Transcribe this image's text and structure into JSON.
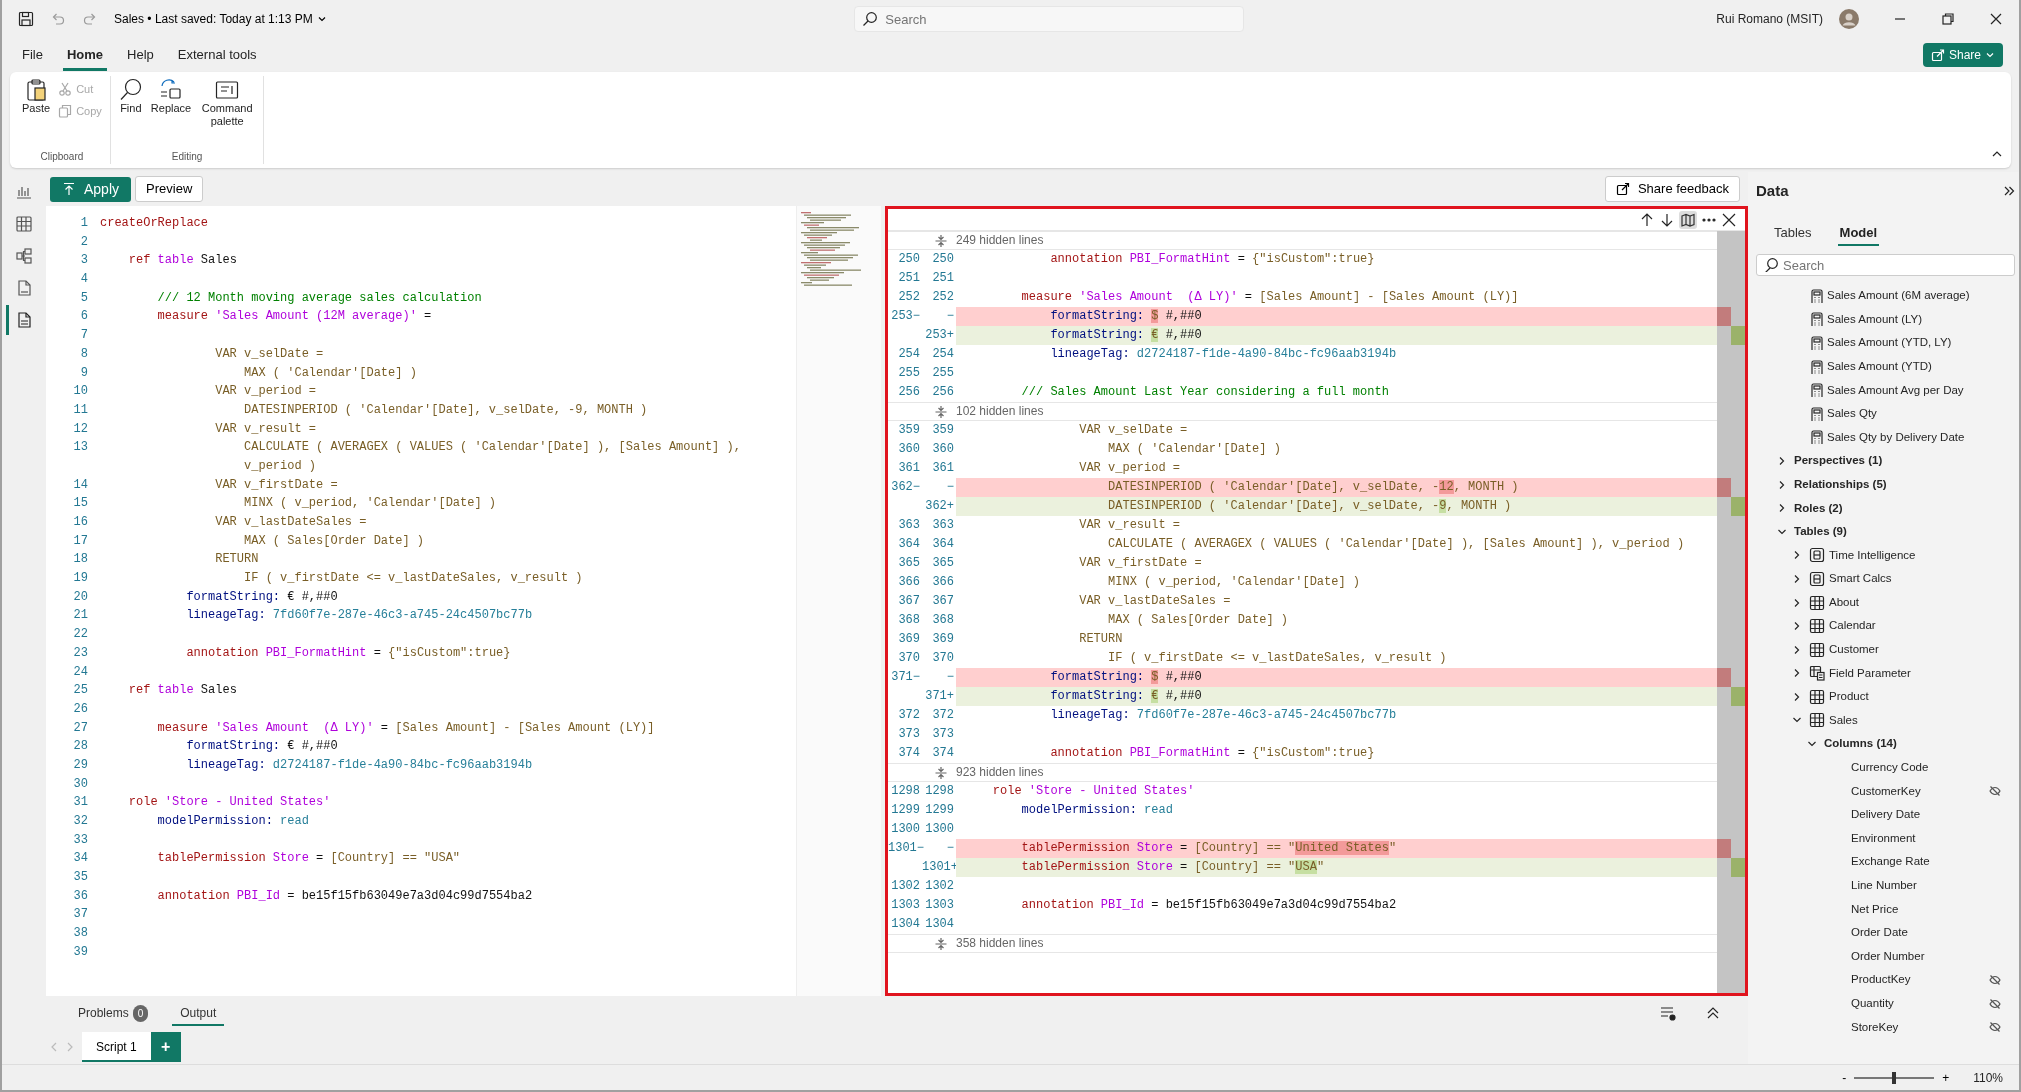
{
  "title_bar": {
    "document": "Sales • Last saved: Today at 1:13 PM",
    "search": {
      "placeholder": "Search"
    },
    "user": "Rui Romano (MSIT)"
  },
  "menu_tabs": [
    {
      "label": "File",
      "selected": false
    },
    {
      "label": "Home",
      "selected": true
    },
    {
      "label": "Help",
      "selected": false
    },
    {
      "label": "External tools",
      "selected": false
    }
  ],
  "share_button": {
    "label": "Share"
  },
  "ribbon": [
    {
      "group": "Clipboard",
      "commands": [
        {
          "label": "Paste",
          "kind": "paste",
          "disabled": false
        },
        {
          "label": "Cut",
          "kind": "cut",
          "disabled": true
        },
        {
          "label": "Copy",
          "kind": "copy",
          "disabled": true
        }
      ]
    },
    {
      "group": "Editing",
      "commands": [
        {
          "label": "Find",
          "kind": "find",
          "disabled": false
        },
        {
          "label": "Replace",
          "kind": "replace",
          "disabled": false
        },
        {
          "label": "Command palette",
          "kind": "palette",
          "disabled": false
        }
      ]
    }
  ],
  "view_rail": [
    {
      "kind": "report",
      "selected": false
    },
    {
      "kind": "table",
      "selected": false
    },
    {
      "kind": "model",
      "selected": false
    },
    {
      "kind": "dax",
      "selected": false
    },
    {
      "kind": "tmdl",
      "selected": true
    }
  ],
  "toolbar": {
    "apply": "Apply",
    "preview": "Preview",
    "share_feedback": "Share feedback"
  },
  "editor": {
    "lines": [
      {
        "number": "1",
        "tokens": [
          {
            "kind": "keyword",
            "text": "createOrReplace"
          }
        ]
      },
      {
        "number": "2"
      },
      {
        "number": "3",
        "tokens": [
          {
            "kind": "keyword",
            "text": "    ref "
          },
          {
            "kind": "name",
            "text": "table"
          },
          {
            "kind": "plain",
            "text": " Sales"
          }
        ]
      },
      {
        "number": "4"
      },
      {
        "number": "5",
        "tokens": [
          {
            "kind": "comment",
            "text": "        /// 12 Month moving average sales calculation"
          }
        ]
      },
      {
        "number": "6",
        "tokens": [
          {
            "kind": "keyword",
            "text": "        measure "
          },
          {
            "kind": "name",
            "text": "'Sales Amount (12M average)'"
          },
          {
            "kind": "plain",
            "text": " ="
          }
        ]
      },
      {
        "number": "7"
      },
      {
        "number": "8",
        "tokens": [
          {
            "kind": "dax",
            "text": "                VAR v_selDate ="
          }
        ]
      },
      {
        "number": "9",
        "tokens": [
          {
            "kind": "dax",
            "text": "                    MAX ( 'Calendar'[Date] )"
          }
        ]
      },
      {
        "number": "10",
        "tokens": [
          {
            "kind": "dax",
            "text": "                VAR v_period ="
          }
        ]
      },
      {
        "number": "11",
        "tokens": [
          {
            "kind": "dax",
            "text": "                    DATESINPERIOD ( 'Calendar'[Date], v_selDate, -9, MONTH )"
          }
        ]
      },
      {
        "number": "12",
        "tokens": [
          {
            "kind": "dax",
            "text": "                VAR v_result ="
          }
        ]
      },
      {
        "number": "13",
        "tokens": [
          {
            "kind": "dax",
            "text": "                    CALCULATE ( AVERAGEX ( VALUES ( 'Calendar'[Date] ), [Sales Amount] ),"
          }
        ]
      },
      {
        "tokens": [
          {
            "kind": "dax",
            "text": "                    v_period )"
          }
        ]
      },
      {
        "number": "14",
        "tokens": [
          {
            "kind": "dax",
            "text": "                VAR v_firstDate ="
          }
        ]
      },
      {
        "number": "15",
        "tokens": [
          {
            "kind": "dax",
            "text": "                    MINX ( v_period, 'Calendar'[Date] )"
          }
        ]
      },
      {
        "number": "16",
        "tokens": [
          {
            "kind": "dax",
            "text": "                VAR v_lastDateSales ="
          }
        ]
      },
      {
        "number": "17",
        "tokens": [
          {
            "kind": "dax",
            "text": "                    MAX ( Sales[Order Date] )"
          }
        ]
      },
      {
        "number": "18",
        "tokens": [
          {
            "kind": "dax",
            "text": "                RETURN"
          }
        ]
      },
      {
        "number": "19",
        "tokens": [
          {
            "kind": "dax",
            "text": "                    IF ( v_firstDate <= v_lastDateSales, v_result )"
          }
        ]
      },
      {
        "number": "20",
        "tokens": [
          {
            "kind": "property",
            "text": "            formatString:"
          },
          {
            "kind": "plain",
            "text": " € #,##0"
          }
        ]
      },
      {
        "number": "21",
        "tokens": [
          {
            "kind": "property",
            "text": "            lineageTag:"
          },
          {
            "kind": "value",
            "text": " 7fd60f7e-287e-46c3-a745-24c4507bc77b"
          }
        ]
      },
      {
        "number": "22"
      },
      {
        "number": "23",
        "tokens": [
          {
            "kind": "keyword",
            "text": "            annotation "
          },
          {
            "kind": "name",
            "text": "PBI_FormatHint"
          },
          {
            "kind": "plain",
            "text": " = "
          },
          {
            "kind": "dax",
            "text": "{\"isCustom\":true}"
          }
        ]
      },
      {
        "number": "24"
      },
      {
        "number": "25",
        "tokens": [
          {
            "kind": "keyword",
            "text": "    ref "
          },
          {
            "kind": "name",
            "text": "table"
          },
          {
            "kind": "plain",
            "text": " Sales"
          }
        ]
      },
      {
        "number": "26"
      },
      {
        "number": "27",
        "tokens": [
          {
            "kind": "keyword",
            "text": "        measure "
          },
          {
            "kind": "name",
            "text": "'Sales Amount  (Δ LY)'"
          },
          {
            "kind": "plain",
            "text": " = "
          },
          {
            "kind": "dax",
            "text": "[Sales Amount] - [Sales Amount (LY)]"
          }
        ]
      },
      {
        "number": "28",
        "tokens": [
          {
            "kind": "property",
            "text": "            formatString:"
          },
          {
            "kind": "plain",
            "text": " € #,##0"
          }
        ]
      },
      {
        "number": "29",
        "tokens": [
          {
            "kind": "property",
            "text": "            lineageTag:"
          },
          {
            "kind": "value",
            "text": " d2724187-f1de-4a90-84bc-fc96aab3194b"
          }
        ]
      },
      {
        "number": "30"
      },
      {
        "number": "31",
        "tokens": [
          {
            "kind": "keyword",
            "text": "    role "
          },
          {
            "kind": "name",
            "text": "'Store - United States'"
          }
        ]
      },
      {
        "number": "32",
        "tokens": [
          {
            "kind": "property",
            "text": "        modelPermission:"
          },
          {
            "kind": "value",
            "text": " read"
          }
        ]
      },
      {
        "number": "33"
      },
      {
        "number": "34",
        "tokens": [
          {
            "kind": "keyword",
            "text": "        tablePermission "
          },
          {
            "kind": "name",
            "text": "Store"
          },
          {
            "kind": "plain",
            "text": " = "
          },
          {
            "kind": "dax",
            "text": "[Country] == \"USA\""
          }
        ]
      },
      {
        "number": "35"
      },
      {
        "number": "36",
        "tokens": [
          {
            "kind": "keyword",
            "text": "        annotation "
          },
          {
            "kind": "name",
            "text": "PBI_Id"
          },
          {
            "kind": "plain",
            "text": " = be15f15fb63049e7a3d04c99d7554ba2"
          }
        ]
      },
      {
        "number": "37"
      },
      {
        "number": "38"
      },
      {
        "number": "39"
      }
    ]
  },
  "diff": {
    "rows": [
      {
        "kind": "hidden",
        "text": "249 hidden lines"
      },
      {
        "kind": "same",
        "old": "250",
        "new": "250",
        "tokens": [
          {
            "kind": "keyword",
            "text": "            annotation "
          },
          {
            "kind": "name",
            "text": "PBI_FormatHint"
          },
          {
            "kind": "plain",
            "text": " = "
          },
          {
            "kind": "dax",
            "text": "{\"isCustom\":true}"
          }
        ]
      },
      {
        "kind": "same",
        "old": "251",
        "new": "251"
      },
      {
        "kind": "same",
        "old": "252",
        "new": "252",
        "tokens": [
          {
            "kind": "keyword",
            "text": "        measure "
          },
          {
            "kind": "name",
            "text": "'Sales Amount  (Δ LY)'"
          },
          {
            "kind": "plain",
            "text": " = "
          },
          {
            "kind": "dax",
            "text": "[Sales Amount] - [Sales Amount (LY)]"
          }
        ]
      },
      {
        "kind": "removed",
        "old": "253−",
        "new": "−",
        "tokens": [
          {
            "kind": "property",
            "text": "            formatString: "
          },
          {
            "kind": "deleted",
            "text": "$"
          },
          {
            "kind": "plain",
            "text": " #,##0"
          }
        ]
      },
      {
        "kind": "added",
        "new": "253+",
        "tokens": [
          {
            "kind": "property",
            "text": "            formatString: "
          },
          {
            "kind": "inserted",
            "text": "€"
          },
          {
            "kind": "plain",
            "text": " #,##0"
          }
        ]
      },
      {
        "kind": "same",
        "old": "254",
        "new": "254",
        "tokens": [
          {
            "kind": "property",
            "text": "            lineageTag:"
          },
          {
            "kind": "value",
            "text": " d2724187-f1de-4a90-84bc-fc96aab3194b"
          }
        ]
      },
      {
        "kind": "same",
        "old": "255",
        "new": "255"
      },
      {
        "kind": "same",
        "old": "256",
        "new": "256",
        "tokens": [
          {
            "kind": "comment",
            "text": "        /// Sales Amount Last Year considering a full month"
          }
        ]
      },
      {
        "kind": "hidden",
        "text": "102 hidden lines"
      },
      {
        "kind": "same",
        "old": "359",
        "new": "359",
        "tokens": [
          {
            "kind": "dax",
            "text": "                VAR v_selDate ="
          }
        ]
      },
      {
        "kind": "same",
        "old": "360",
        "new": "360",
        "tokens": [
          {
            "kind": "dax",
            "text": "                    MAX ( 'Calendar'[Date] )"
          }
        ]
      },
      {
        "kind": "same",
        "old": "361",
        "new": "361",
        "tokens": [
          {
            "kind": "dax",
            "text": "                VAR v_period ="
          }
        ]
      },
      {
        "kind": "removed",
        "old": "362−",
        "new": "−",
        "tokens": [
          {
            "kind": "dax",
            "text": "                    DATESINPERIOD ( 'Calendar'[Date], v_selDate, -"
          },
          {
            "kind": "deleted",
            "text": "12"
          },
          {
            "kind": "dax",
            "text": ", MONTH )"
          }
        ]
      },
      {
        "kind": "added",
        "new": "362+",
        "tokens": [
          {
            "kind": "dax",
            "text": "                    DATESINPERIOD ( 'Calendar'[Date], v_selDate, -"
          },
          {
            "kind": "inserted",
            "text": "9"
          },
          {
            "kind": "dax",
            "text": ", MONTH )"
          }
        ]
      },
      {
        "kind": "same",
        "old": "363",
        "new": "363",
        "tokens": [
          {
            "kind": "dax",
            "text": "                VAR v_result ="
          }
        ]
      },
      {
        "kind": "same",
        "old": "364",
        "new": "364",
        "tokens": [
          {
            "kind": "dax",
            "text": "                    CALCULATE ( AVERAGEX ( VALUES ( 'Calendar'[Date] ), [Sales Amount] ), v_period )"
          }
        ]
      },
      {
        "kind": "same",
        "old": "365",
        "new": "365",
        "tokens": [
          {
            "kind": "dax",
            "text": "                VAR v_firstDate ="
          }
        ]
      },
      {
        "kind": "same",
        "old": "366",
        "new": "366",
        "tokens": [
          {
            "kind": "dax",
            "text": "                    MINX ( v_period, 'Calendar'[Date] )"
          }
        ]
      },
      {
        "kind": "same",
        "old": "367",
        "new": "367",
        "tokens": [
          {
            "kind": "dax",
            "text": "                VAR v_lastDateSales ="
          }
        ]
      },
      {
        "kind": "same",
        "old": "368",
        "new": "368",
        "tokens": [
          {
            "kind": "dax",
            "text": "                    MAX ( Sales[Order Date] )"
          }
        ]
      },
      {
        "kind": "same",
        "old": "369",
        "new": "369",
        "tokens": [
          {
            "kind": "dax",
            "text": "                RETURN"
          }
        ]
      },
      {
        "kind": "same",
        "old": "370",
        "new": "370",
        "tokens": [
          {
            "kind": "dax",
            "text": "                    IF ( v_firstDate <= v_lastDateSales, v_result )"
          }
        ]
      },
      {
        "kind": "removed",
        "old": "371−",
        "new": "−",
        "tokens": [
          {
            "kind": "property",
            "text": "            formatString: "
          },
          {
            "kind": "deleted",
            "text": "$"
          },
          {
            "kind": "plain",
            "text": " #,##0"
          }
        ]
      },
      {
        "kind": "added",
        "new": "371+",
        "tokens": [
          {
            "kind": "property",
            "text": "            formatString: "
          },
          {
            "kind": "inserted",
            "text": "€"
          },
          {
            "kind": "plain",
            "text": " #,##0"
          }
        ]
      },
      {
        "kind": "same",
        "old": "372",
        "new": "372",
        "tokens": [
          {
            "kind": "property",
            "text": "            lineageTag:"
          },
          {
            "kind": "value",
            "text": " 7fd60f7e-287e-46c3-a745-24c4507bc77b"
          }
        ]
      },
      {
        "kind": "same",
        "old": "373",
        "new": "373"
      },
      {
        "kind": "same",
        "old": "374",
        "new": "374",
        "tokens": [
          {
            "kind": "keyword",
            "text": "            annotation "
          },
          {
            "kind": "name",
            "text": "PBI_FormatHint"
          },
          {
            "kind": "plain",
            "text": " = "
          },
          {
            "kind": "dax",
            "text": "{\"isCustom\":true}"
          }
        ]
      },
      {
        "kind": "hidden",
        "text": "923 hidden lines"
      },
      {
        "kind": "same",
        "old": "1298",
        "new": "1298",
        "tokens": [
          {
            "kind": "keyword",
            "text": "    role "
          },
          {
            "kind": "name",
            "text": "'Store - United States'"
          }
        ]
      },
      {
        "kind": "same",
        "old": "1299",
        "new": "1299",
        "tokens": [
          {
            "kind": "property",
            "text": "        modelPermission:"
          },
          {
            "kind": "value",
            "text": " read"
          }
        ]
      },
      {
        "kind": "same",
        "old": "1300",
        "new": "1300"
      },
      {
        "kind": "removed",
        "old": "1301−",
        "new": "−",
        "tokens": [
          {
            "kind": "keyword",
            "text": "        tablePermission "
          },
          {
            "kind": "name",
            "text": "Store"
          },
          {
            "kind": "plain",
            "text": " = "
          },
          {
            "kind": "dax",
            "text": "[Country] == \""
          },
          {
            "kind": "deleted",
            "text": "United States"
          },
          {
            "kind": "dax",
            "text": "\""
          }
        ]
      },
      {
        "kind": "added",
        "new": "1301+",
        "tokens": [
          {
            "kind": "keyword",
            "text": "        tablePermission "
          },
          {
            "kind": "name",
            "text": "Store"
          },
          {
            "kind": "plain",
            "text": " = "
          },
          {
            "kind": "dax",
            "text": "[Country] == \""
          },
          {
            "kind": "inserted",
            "text": "USA"
          },
          {
            "kind": "dax",
            "text": "\""
          }
        ]
      },
      {
        "kind": "same",
        "old": "1302",
        "new": "1302"
      },
      {
        "kind": "same",
        "old": "1303",
        "new": "1303",
        "tokens": [
          {
            "kind": "keyword",
            "text": "        annotation "
          },
          {
            "kind": "name",
            "text": "PBI_Id"
          },
          {
            "kind": "plain",
            "text": " = be15f15fb63049e7a3d04c99d7554ba2"
          }
        ]
      },
      {
        "kind": "same",
        "old": "1304",
        "new": "1304"
      },
      {
        "kind": "hidden",
        "text": "358 hidden lines"
      }
    ]
  },
  "data_pane": {
    "title": "Data",
    "tabs": [
      {
        "label": "Tables",
        "selected": false
      },
      {
        "label": "Model",
        "selected": true
      }
    ],
    "search": {
      "placeholder": "Search"
    },
    "measures": [
      "Sales Amount (6M average)",
      "Sales Amount (LY)",
      "Sales Amount (YTD, LY)",
      "Sales Amount (YTD)",
      "Sales Amount Avg per Day",
      "Sales Qty",
      "Sales Qty by Delivery Date"
    ],
    "tree": [
      {
        "label": "Perspectives (1)",
        "kind": "folder",
        "expanded": false
      },
      {
        "label": "Relationships (5)",
        "kind": "folder",
        "expanded": false
      },
      {
        "label": "Roles (2)",
        "kind": "folder",
        "expanded": false
      },
      {
        "label": "Tables (9)",
        "kind": "folder",
        "expanded": true,
        "children": [
          {
            "label": "Time Intelligence",
            "kind": "calc-group",
            "expanded": false
          },
          {
            "label": "Smart Calcs",
            "kind": "calc-group",
            "expanded": false
          },
          {
            "label": "About",
            "kind": "table",
            "expanded": false
          },
          {
            "label": "Calendar",
            "kind": "table",
            "expanded": false
          },
          {
            "label": "Customer",
            "kind": "table",
            "expanded": false
          },
          {
            "label": "Field Parameter",
            "kind": "parameter",
            "expanded": false
          },
          {
            "label": "Product",
            "kind": "table",
            "expanded": false
          },
          {
            "label": "Sales",
            "kind": "table",
            "expanded": true,
            "children": [
              {
                "label": "Columns (14)",
                "kind": "folder",
                "expanded": true,
                "children": [
                  {
                    "label": "Currency Code",
                    "kind": "column",
                    "hidden": false
                  },
                  {
                    "label": "CustomerKey",
                    "kind": "column",
                    "hidden": true
                  },
                  {
                    "label": "Delivery Date",
                    "kind": "column",
                    "hidden": false
                  },
                  {
                    "label": "Environment",
                    "kind": "column",
                    "hidden": false
                  },
                  {
                    "label": "Exchange Rate",
                    "kind": "column",
                    "hidden": false
                  },
                  {
                    "label": "Line Number",
                    "kind": "column",
                    "hidden": false
                  },
                  {
                    "label": "Net Price",
                    "kind": "column",
                    "hidden": false
                  },
                  {
                    "label": "Order Date",
                    "kind": "column",
                    "hidden": false
                  },
                  {
                    "label": "Order Number",
                    "kind": "column",
                    "hidden": false
                  },
                  {
                    "label": "ProductKey",
                    "kind": "column",
                    "hidden": true
                  },
                  {
                    "label": "Quantity",
                    "kind": "column",
                    "hidden": true
                  },
                  {
                    "label": "StoreKey",
                    "kind": "column",
                    "hidden": true
                  }
                ]
              }
            ]
          }
        ]
      }
    ]
  },
  "output_panel": {
    "tabs": [
      {
        "label": "Problems",
        "count": "0",
        "selected": false
      },
      {
        "label": "Output",
        "selected": true
      }
    ]
  },
  "script_tabs": [
    {
      "label": "Script 1",
      "selected": true
    }
  ],
  "add_script": "+",
  "status_bar": {
    "minus": "-",
    "plus": "+",
    "zoom": "110%",
    "level": 0.5
  }
}
